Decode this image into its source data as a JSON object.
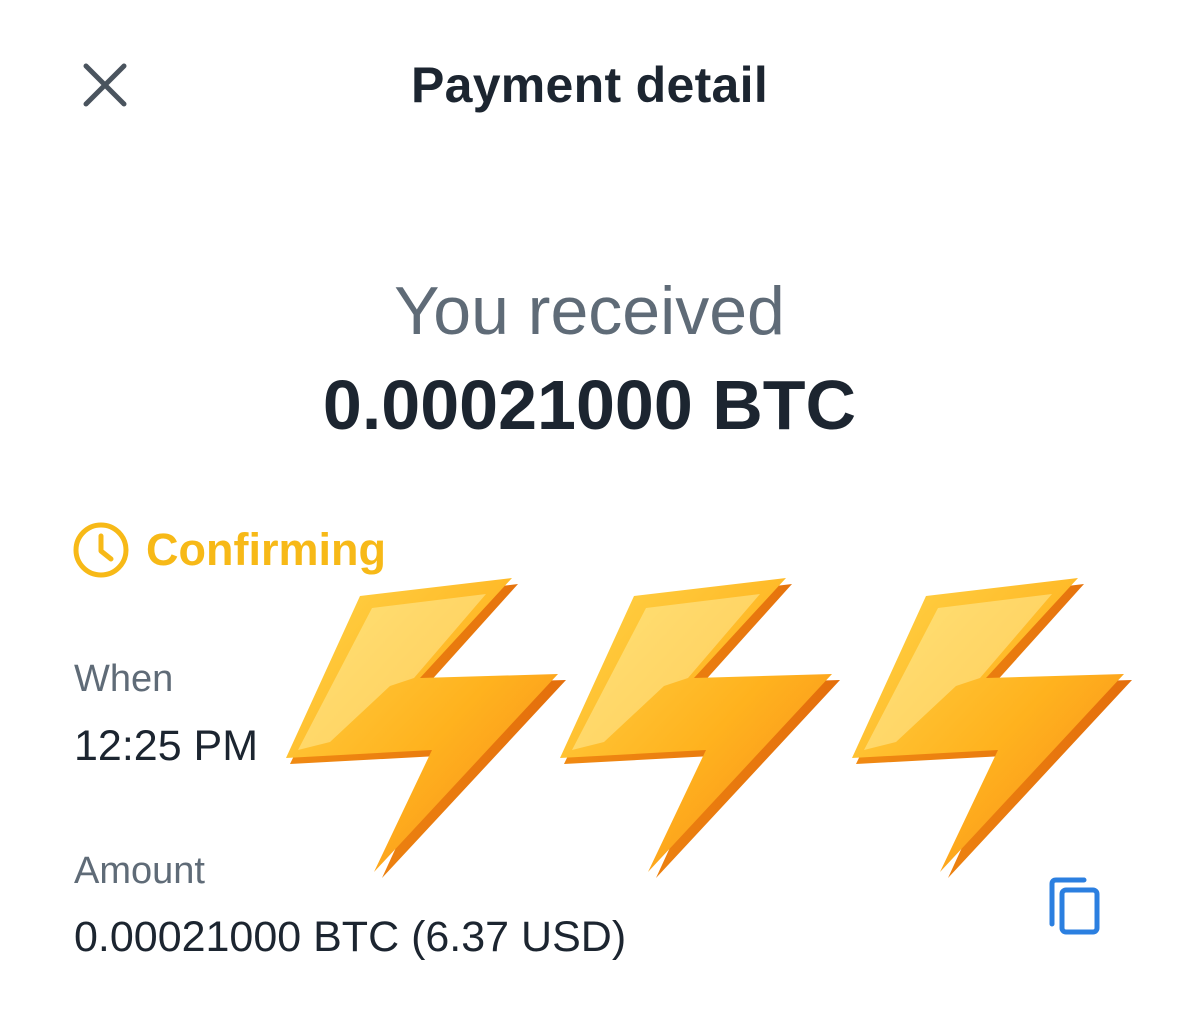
{
  "header": {
    "title": "Payment detail",
    "close_icon": "close-icon"
  },
  "summary": {
    "label": "You received",
    "amount": "0.00021000 BTC"
  },
  "status": {
    "label": "Confirming",
    "icon": "clock-icon",
    "color": "#f7b917"
  },
  "details": {
    "when": {
      "label": "When",
      "value": "12:25 PM"
    },
    "amount": {
      "label": "Amount",
      "value": "0.00021000 BTC (6.37 USD)",
      "copy_icon": "copy-icon"
    }
  },
  "overlay": {
    "emoji": "high-voltage-icon",
    "count": 3
  },
  "colors": {
    "text_primary": "#1c2530",
    "text_secondary": "#5f6b77",
    "accent_blue": "#2b7fe0",
    "status_pending": "#f7b917",
    "bolt_orange": "#f7941d"
  }
}
